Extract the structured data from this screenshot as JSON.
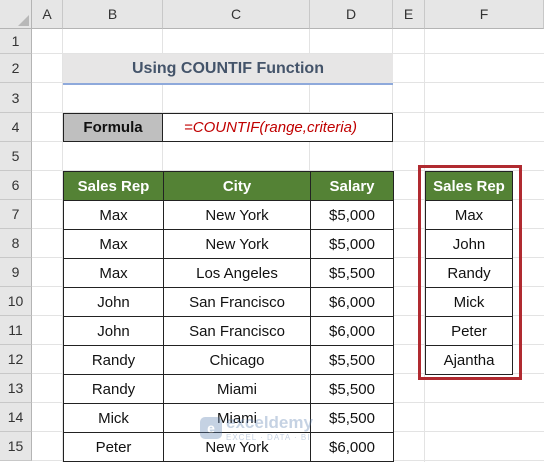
{
  "columns": [
    "A",
    "B",
    "C",
    "D",
    "E",
    "F"
  ],
  "rows": [
    "1",
    "2",
    "3",
    "4",
    "5",
    "6",
    "7",
    "8",
    "9",
    "10",
    "11",
    "12",
    "13",
    "14",
    "15"
  ],
  "title": "Using COUNTIF Function",
  "formula": {
    "label": "Formula",
    "value": "=COUNTIF(range,criteria)"
  },
  "table": {
    "headers": [
      "Sales Rep",
      "City",
      "Salary"
    ],
    "rows": [
      [
        "Max",
        "New York",
        "$5,000"
      ],
      [
        "Max",
        "New York",
        "$5,000"
      ],
      [
        "Max",
        "Los Angeles",
        "$5,500"
      ],
      [
        "John",
        "San Francisco",
        "$6,000"
      ],
      [
        "John",
        "San Francisco",
        "$6,000"
      ],
      [
        "Randy",
        "Chicago",
        "$5,500"
      ],
      [
        "Randy",
        "Miami",
        "$5,500"
      ],
      [
        "Mick",
        "Miami",
        "$5,500"
      ],
      [
        "Peter",
        "New York",
        "$6,000"
      ]
    ]
  },
  "reps": {
    "header": "Sales Rep",
    "items": [
      "Max",
      "John",
      "Randy",
      "Mick",
      "Peter",
      "Ajantha"
    ]
  },
  "watermark": {
    "name": "exceldemy",
    "tagline": "EXCEL · DATA · BI"
  },
  "colors": {
    "header_green": "#548235",
    "formula_red": "#c00000",
    "highlight_border": "#b02a30"
  }
}
